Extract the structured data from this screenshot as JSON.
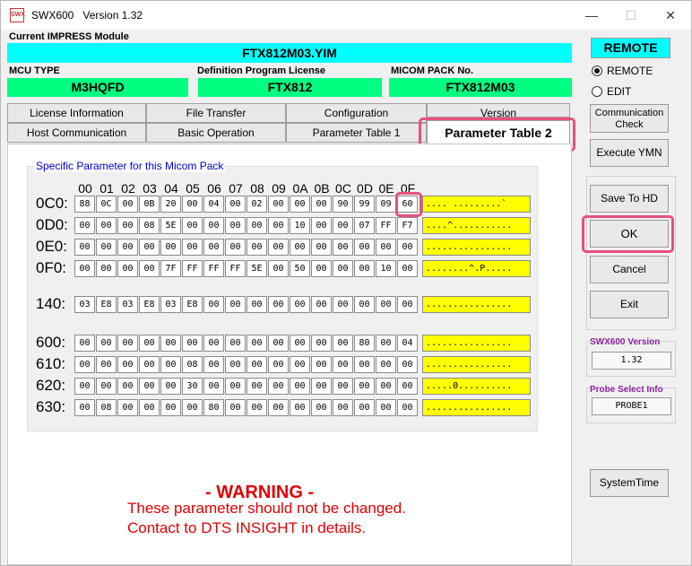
{
  "window": {
    "title": "SWX600",
    "version_label": "Version  1.32",
    "icon_text": "SWX"
  },
  "labels": {
    "module": "Current IMPRESS Module",
    "mcu_type": "MCU TYPE",
    "def_license": "Definition Program License",
    "micom_pack": "MICOM PACK No."
  },
  "values": {
    "module": "FTX812M03.YIM",
    "mcu_type": "M3HQFD",
    "def_license": "FTX812",
    "micom_pack": "FTX812M03"
  },
  "tabs_row1": [
    "License Information",
    "File Transfer",
    "Configuration",
    "Version"
  ],
  "tabs_row2": [
    "Host Communication",
    "Basic Operation",
    "Parameter Table 1",
    "Parameter Table 2"
  ],
  "group_title": "Specific Parameter for this Micom Pack",
  "columns": [
    "00",
    "01",
    "02",
    "03",
    "04",
    "05",
    "06",
    "07",
    "08",
    "09",
    "0A",
    "0B",
    "0C",
    "0D",
    "0E",
    "0F"
  ],
  "rows": [
    {
      "addr": "0C0:",
      "bytes": [
        "88",
        "0C",
        "00",
        "0B",
        "20",
        "00",
        "04",
        "00",
        "02",
        "00",
        "00",
        "00",
        "90",
        "99",
        "09",
        "60"
      ],
      "ascii": ".... .........`"
    },
    {
      "addr": "0D0:",
      "bytes": [
        "00",
        "00",
        "00",
        "08",
        "5E",
        "00",
        "00",
        "00",
        "00",
        "00",
        "10",
        "00",
        "00",
        "07",
        "FF",
        "F7"
      ],
      "ascii": "....^..........."
    },
    {
      "addr": "0E0:",
      "bytes": [
        "00",
        "00",
        "00",
        "00",
        "00",
        "00",
        "00",
        "00",
        "00",
        "00",
        "00",
        "00",
        "00",
        "00",
        "00",
        "00"
      ],
      "ascii": "................"
    },
    {
      "addr": "0F0:",
      "bytes": [
        "00",
        "00",
        "00",
        "00",
        "7F",
        "FF",
        "FF",
        "FF",
        "5E",
        "00",
        "50",
        "00",
        "00",
        "00",
        "10",
        "00"
      ],
      "ascii": "........^.P....."
    },
    {
      "addr": "140:",
      "bytes": [
        "03",
        "E8",
        "03",
        "E8",
        "03",
        "E8",
        "00",
        "00",
        "00",
        "00",
        "00",
        "00",
        "00",
        "00",
        "00",
        "00"
      ],
      "ascii": "................"
    },
    {
      "addr": "600:",
      "bytes": [
        "00",
        "00",
        "00",
        "00",
        "00",
        "00",
        "00",
        "00",
        "00",
        "00",
        "00",
        "00",
        "00",
        "80",
        "00",
        "04"
      ],
      "ascii": "................"
    },
    {
      "addr": "610:",
      "bytes": [
        "00",
        "00",
        "00",
        "00",
        "00",
        "08",
        "00",
        "00",
        "00",
        "00",
        "00",
        "00",
        "00",
        "00",
        "00",
        "00"
      ],
      "ascii": "................"
    },
    {
      "addr": "620:",
      "bytes": [
        "00",
        "00",
        "00",
        "00",
        "00",
        "30",
        "00",
        "00",
        "00",
        "00",
        "00",
        "00",
        "00",
        "00",
        "00",
        "00"
      ],
      "ascii": ".....0.........."
    },
    {
      "addr": "630:",
      "bytes": [
        "00",
        "08",
        "00",
        "00",
        "00",
        "00",
        "80",
        "00",
        "00",
        "00",
        "00",
        "00",
        "00",
        "00",
        "00",
        "00"
      ],
      "ascii": "................"
    }
  ],
  "warning": {
    "title": "- WARNING -",
    "line1": "These parameter should not be changed.",
    "line2": "Contact to DTS INSIGHT in details."
  },
  "right": {
    "mode_badge": "REMOTE",
    "radio_remote": "REMOTE",
    "radio_edit": "EDIT",
    "comm_check_1": "Communication",
    "comm_check_2": "Check",
    "execute_ymn": "Execute YMN",
    "save_to_hd": "Save To HD",
    "ok": "OK",
    "cancel": "Cancel",
    "exit": "Exit",
    "version_title": "SWX600 Version",
    "version_value": "1.32",
    "probe_title": "Probe Select Info",
    "probe_value": "PROBE1",
    "system_time": "SystemTime"
  },
  "colors": {
    "cyan": "#00ffff",
    "green": "#00ff80",
    "yellow": "#ffff00",
    "highlight": "#e8507a",
    "warning": "#e00000"
  }
}
